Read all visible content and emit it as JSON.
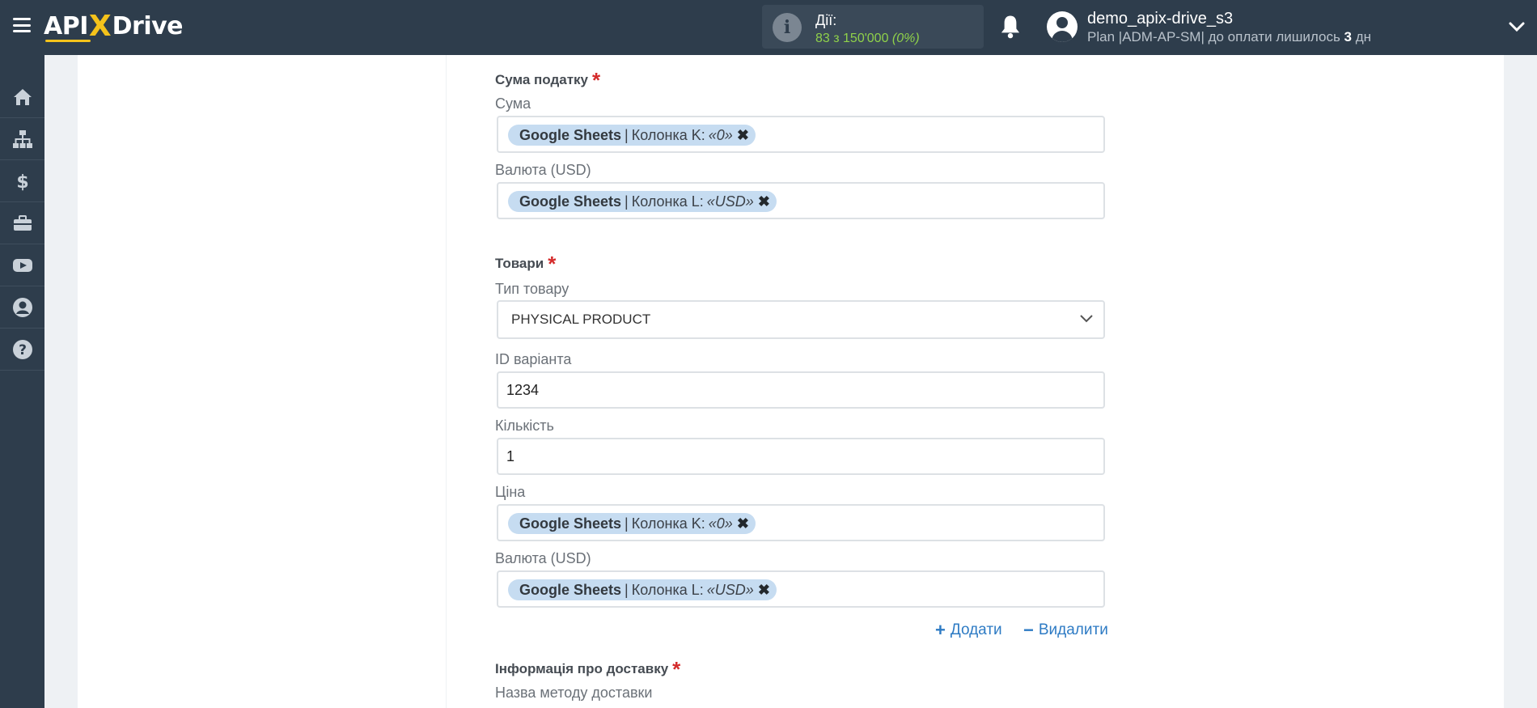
{
  "header": {
    "logo": {
      "part1": "API",
      "x": "X",
      "part2": "Drive"
    },
    "actions": {
      "label": "Дії:",
      "count": "83 з 150'000",
      "percent": "(0%)"
    },
    "user": {
      "name": "demo_apix-drive_s3",
      "plan_prefix": "Plan |ADM-AP-SM| до оплати лишилось ",
      "days": "3",
      "days_suffix": " дн"
    }
  },
  "sidebar": {
    "items": [
      "home-icon",
      "sitemap-icon",
      "dollar-icon",
      "briefcase-icon",
      "youtube-icon",
      "user-icon",
      "help-icon"
    ]
  },
  "form": {
    "tax_section": {
      "title": "Сума податку",
      "amount_label": "Сума",
      "amount_chip": {
        "source": "Google Sheets",
        "sep": "|",
        "column": "Колонка K:",
        "value": "«0»"
      },
      "currency_label": "Валюта (USD)",
      "currency_chip": {
        "source": "Google Sheets",
        "sep": "|",
        "column": "Колонка L:",
        "value": "«USD»"
      }
    },
    "goods_section": {
      "title": "Товари",
      "type_label": "Тип товару",
      "type_value": "PHYSICAL PRODUCT",
      "variant_label": "ID варіанта",
      "variant_value": "1234",
      "qty_label": "Кількість",
      "qty_value": "1",
      "price_label": "Ціна",
      "price_chip": {
        "source": "Google Sheets",
        "sep": "|",
        "column": "Колонка K:",
        "value": "«0»"
      },
      "currency_label": "Валюта (USD)",
      "currency_chip": {
        "source": "Google Sheets",
        "sep": "|",
        "column": "Колонка L:",
        "value": "«USD»"
      },
      "add_label": "Додати",
      "remove_label": "Видалити"
    },
    "delivery_section": {
      "title": "Інформація про доставку",
      "method_label": "Назва методу доставки"
    }
  },
  "colors": {
    "topbar": "#2e3d4c",
    "accent_yellow": "#f4c21b",
    "chip_bg": "#c6dcf1",
    "link": "#2e7bc4",
    "required": "#d42b2b",
    "count_green": "#8fd14a"
  }
}
